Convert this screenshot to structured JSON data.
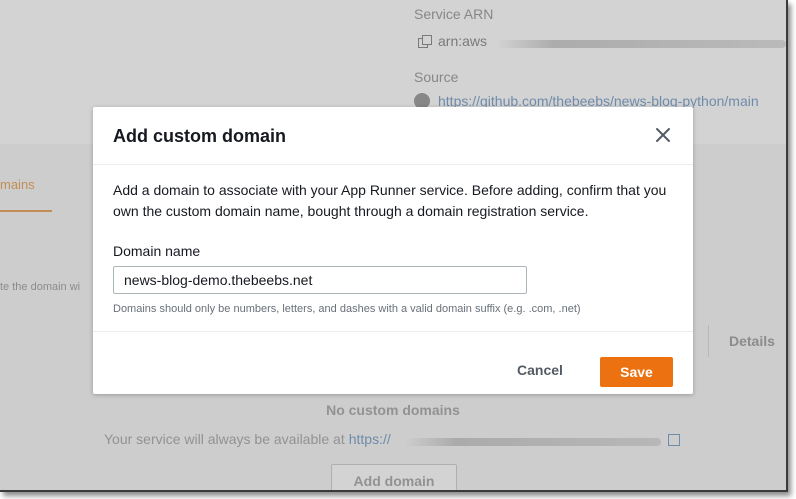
{
  "background": {
    "service_arn_label": "Service ARN",
    "service_arn_value": "arn:aws",
    "source_label": "Source",
    "source_link": "https://github.com/thebeebs/news-blog-python/main",
    "tab_label": "mains",
    "tab_hint": "te the domain wi",
    "details_label": "Details",
    "no_domains": "No custom domains",
    "availability_text": "Your service will always be available at",
    "availability_link": "https://",
    "add_domain_button": "Add domain"
  },
  "modal": {
    "title": "Add custom domain",
    "description": "Add a domain to associate with your App Runner service. Before adding, confirm that you own the custom domain name, bought through a domain registration service.",
    "domain_field": {
      "label": "Domain name",
      "value": "news-blog-demo.thebeebs.net",
      "hint": "Domains should only be numbers, letters, and dashes with a valid domain suffix (e.g. .com, .net)"
    },
    "cancel_label": "Cancel",
    "save_label": "Save"
  },
  "colors": {
    "primary_button": "#ec7211",
    "link": "#0073bb",
    "text": "#16191f",
    "muted_text": "#687078"
  },
  "icons": [
    "copy-icon",
    "github-icon",
    "close-icon",
    "external-link-icon"
  ]
}
